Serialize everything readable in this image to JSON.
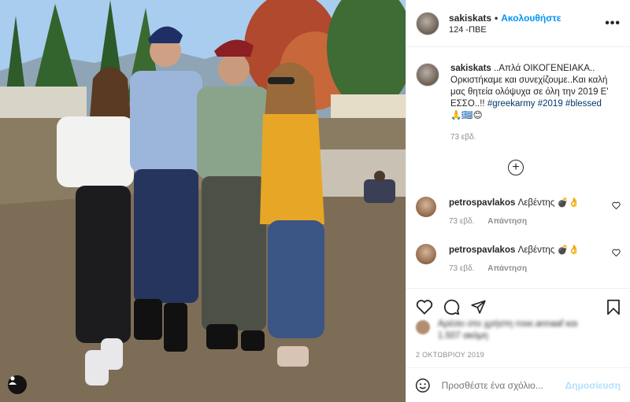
{
  "post": {
    "username": "sakiskats",
    "follow_label": "Ακολουθήστε",
    "location": "124 -ΠΒΕ",
    "more_label": "•••",
    "caption_text": " ..Απλά ΟΙΚΟΓΕΝΕΙΑΚΑ.. Ορκιστήκαμε και συνεχίζουμε..Και καλή μας θητεία ολόψυχα σε όλη την 2019 Ε' ΕΣΣΟ..!! ",
    "hashtag1": "#greekarmy",
    "hashtag2": "#2019",
    "hashtag3": "#blessed",
    "caption_emoji": "🙏🇬🇷😊",
    "caption_time": "73 εβδ.",
    "load_more": "+"
  },
  "comments": [
    {
      "username": "petrospavlakos",
      "text": " Λεβέντης 💣👌",
      "time": "73 εβδ.",
      "reply": "Απάντηση"
    },
    {
      "username": "petrospavlakos",
      "text": " Λεβέντης 💣👌",
      "time": "73 εβδ.",
      "reply": "Απάντηση"
    }
  ],
  "likes": {
    "text": "Αρέσει στο χρήστη rose.annaaf και 1.507 ακόμη"
  },
  "date": "2 ΟΚΤΩΒΡΙΟΥ 2019",
  "add_comment": {
    "placeholder": "Προσθέστε ένα σχόλιο...",
    "publish_label": "Δημοσίευση"
  },
  "icons": {
    "heart": "heart-icon",
    "comment": "comment-icon",
    "share": "share-icon",
    "save": "bookmark-icon",
    "emoji": "emoji-icon",
    "user_tag": "user-icon"
  },
  "colors": {
    "follow_blue": "#0095f6",
    "publish_disabled": "#b2dffc",
    "hashtag": "#00376b",
    "meta_grey": "#8e8e8e"
  }
}
